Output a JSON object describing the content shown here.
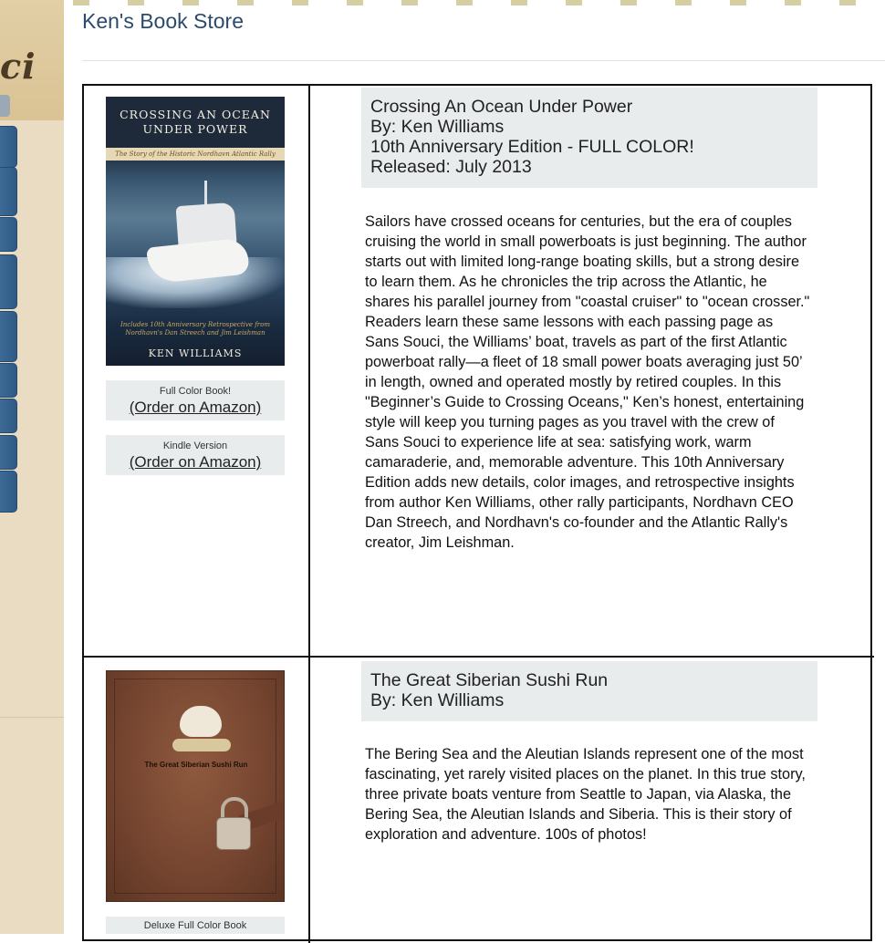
{
  "sidebar": {
    "logo_text": "ci"
  },
  "site": {
    "title": "Ken's Book Store"
  },
  "books": [
    {
      "header": {
        "title": "Crossing An Ocean Under Power",
        "author": "By: Ken Williams",
        "edition": "10th Anniversary Edition - FULL COLOR!",
        "released": "Released: July 2013"
      },
      "cover": {
        "title_line1": "Crossing an Ocean",
        "title_line2": "Under Power",
        "band": "The Story of the Historic Nordhavn Atlantic Rally",
        "subtitle": "Includes 10th Anniversary Retrospective from Nordhavn's Dan Streech and Jim Leishman",
        "author": "KEN WILLIAMS"
      },
      "orders": [
        {
          "caption": "Full Color Book!",
          "link": "(Order on Amazon)"
        },
        {
          "caption": "Kindle Version",
          "link": "(Order on Amazon)"
        }
      ],
      "description": "Sailors have crossed oceans for centuries, but the era of couples cruising the world in small powerboats is just beginning. The author starts out with limited long-range boating skills, but a strong desire to learn them. As he chronicles the trip across the Atlantic, he shares his parallel journey from \"coastal cruiser\" to \"ocean crosser.\" Readers learn these same lessons with each passing page as Sans Souci, the Williams’ boat, travels as part of the first Atlantic powerboat rally—a fleet of 18 small power boats averaging just 50’ in length, owned and operated mostly by retired couples. In this \"Beginner’s Guide to Crossing Oceans,\" Ken’s honest, entertaining style will keep you turning pages as you travel with the crew of Sans Souci to experience life at sea: satisfying work, warm camaraderie, and, memorable adventure. This 10th Anniversary Edition adds new details, color images, and retrospective insights from author Ken Williams, other rally participants, Nordhavn CEO Dan Streech, and Nordhavn's co-founder and the Atlantic Rally's creator, Jim Leishman."
    },
    {
      "header": {
        "title": "The Great Siberian Sushi Run",
        "author": "By: Ken Williams"
      },
      "cover": {
        "title": "The Great Siberian Sushi Run"
      },
      "orders": [
        {
          "caption": "Deluxe Full Color Book"
        }
      ],
      "description": "The Bering Sea and the Aleutian Islands represent one of the most fascinating, yet rarely visited places on the planet. In this true story, three private boats venture from Seattle to Japan, via Alaska, the Bering Sea, the Aleutian Islands and Siberia. This is their story of exploration and adventure. 100s of photos!"
    }
  ]
}
